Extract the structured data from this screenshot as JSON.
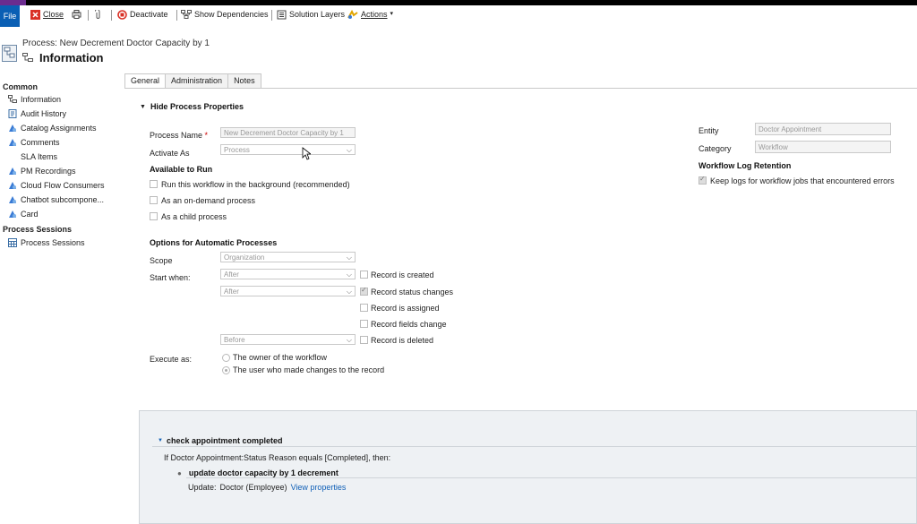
{
  "toolbar": {
    "file": "File",
    "close": "Close",
    "deactivate": "Deactivate",
    "show_dependencies": "Show Dependencies",
    "solution_layers": "Solution Layers",
    "actions": "Actions"
  },
  "header": {
    "subtitle": "Process: New Decrement Doctor Capacity by 1",
    "title": "Information"
  },
  "sidebar": {
    "group_common": "Common",
    "items": [
      "Information",
      "Audit History",
      "Catalog Assignments",
      "Comments",
      "SLA Items",
      "PM Recordings",
      "Cloud Flow Consumers",
      "Chatbot subcompone...",
      "Card"
    ],
    "group_sessions": "Process Sessions",
    "session_items": [
      "Process Sessions"
    ]
  },
  "tabs": [
    "General",
    "Administration",
    "Notes"
  ],
  "props": {
    "toggle": "Hide Process Properties",
    "process_name_label": "Process Name",
    "process_name_value": "New Decrement Doctor Capacity by 1",
    "activate_as_label": "Activate As",
    "activate_as_value": "Process",
    "available_title": "Available to Run",
    "run_background": "Run this workflow in the background (recommended)",
    "on_demand": "As an on-demand process",
    "child_process": "As a child process",
    "auto_title": "Options for Automatic Processes",
    "scope_label": "Scope",
    "scope_value": "Organization",
    "start_when_label": "Start when:",
    "start_after_1": "After",
    "start_after_2": "After",
    "start_before": "Before",
    "record_created": "Record is created",
    "record_status": "Record status changes",
    "record_assigned": "Record is assigned",
    "record_fields": "Record fields change",
    "record_deleted": "Record is deleted",
    "execute_as_label": "Execute as:",
    "exec_owner": "The owner of the workflow",
    "exec_user": "The user who made changes to the record",
    "entity_label": "Entity",
    "entity_value": "Doctor Appointment",
    "category_label": "Category",
    "category_value": "Workflow",
    "log_title": "Workflow Log Retention",
    "log_keep": "Keep logs for workflow jobs that encountered errors"
  },
  "steps": {
    "stage_title": "check appointment completed",
    "condition": "If Doctor Appointment:Status Reason equals [Completed], then:",
    "step_title": "update doctor capacity by 1 decrement",
    "update_label": "Update:",
    "update_target": "Doctor (Employee)",
    "view_properties": "View properties"
  }
}
